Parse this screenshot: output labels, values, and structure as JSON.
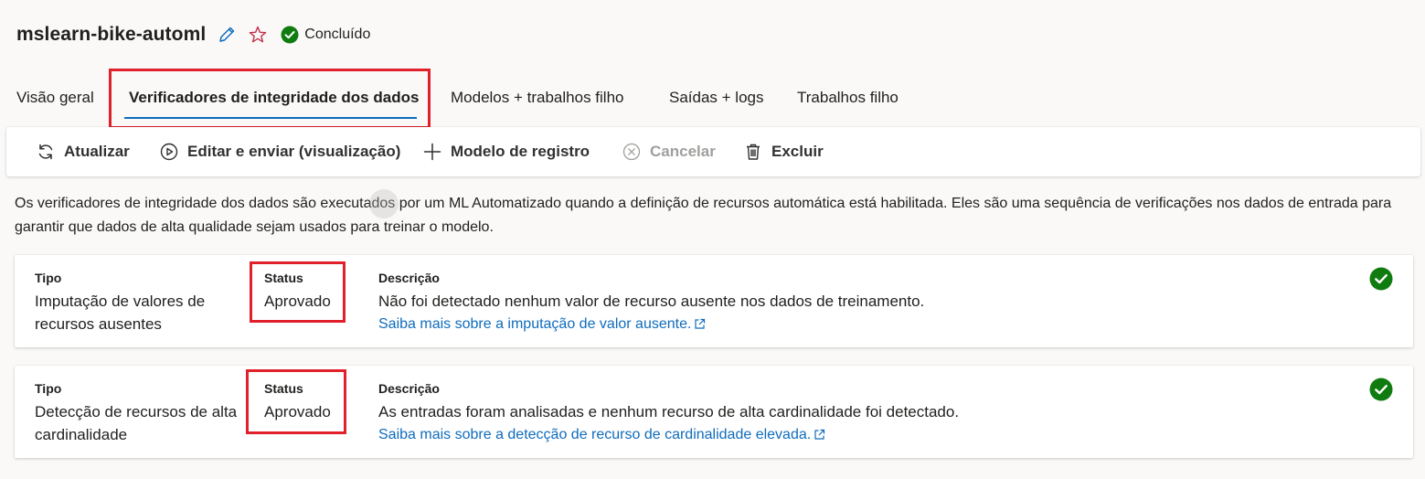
{
  "header": {
    "title": "mslearn-bike-automl",
    "status_text": "Concluído",
    "icons": {
      "edit": "pencil-icon",
      "favorite": "star-icon",
      "status": "check-circle-icon"
    }
  },
  "tabs": [
    {
      "label": "Visão geral",
      "active": false
    },
    {
      "label": "Verificadores de integridade dos dados",
      "active": true
    },
    {
      "label": "Modelos + trabalhos filho",
      "active": false
    },
    {
      "label": "Saídas + logs",
      "active": false
    },
    {
      "label": "Trabalhos filho",
      "active": false
    }
  ],
  "toolbar": {
    "refresh": "Atualizar",
    "edit_submit": "Editar e enviar (visualização)",
    "register_model": "Modelo de registro",
    "cancel": "Cancelar",
    "delete": "Excluir"
  },
  "intro_text": "Os verificadores de integridade dos dados são executados por um ML Automatizado quando a definição de recursos automática está habilitada. Eles são uma sequência de verificações nos dados de entrada para garantir que dados de alta qualidade sejam usados para treinar o modelo.",
  "columns": {
    "type": "Tipo",
    "status": "Status",
    "description": "Descrição"
  },
  "checks": [
    {
      "type": "Imputação de valores de recursos ausentes",
      "status": "Aprovado",
      "description": "Não foi detectado nenhum valor de recurso ausente nos dados de treinamento.",
      "link": "Saiba mais sobre a imputação de valor ausente."
    },
    {
      "type": "Detecção de recursos de alta cardinalidade",
      "status": "Aprovado",
      "description": "As entradas foram analisadas e nenhum recurso de alta cardinalidade foi detectado.",
      "link": "Saiba mais sobre a detecção de recurso de cardinalidade elevada."
    }
  ],
  "colors": {
    "accent": "#0f6cbd",
    "success": "#107c10",
    "highlight": "#e0202a",
    "favorite": "#c4314b"
  }
}
